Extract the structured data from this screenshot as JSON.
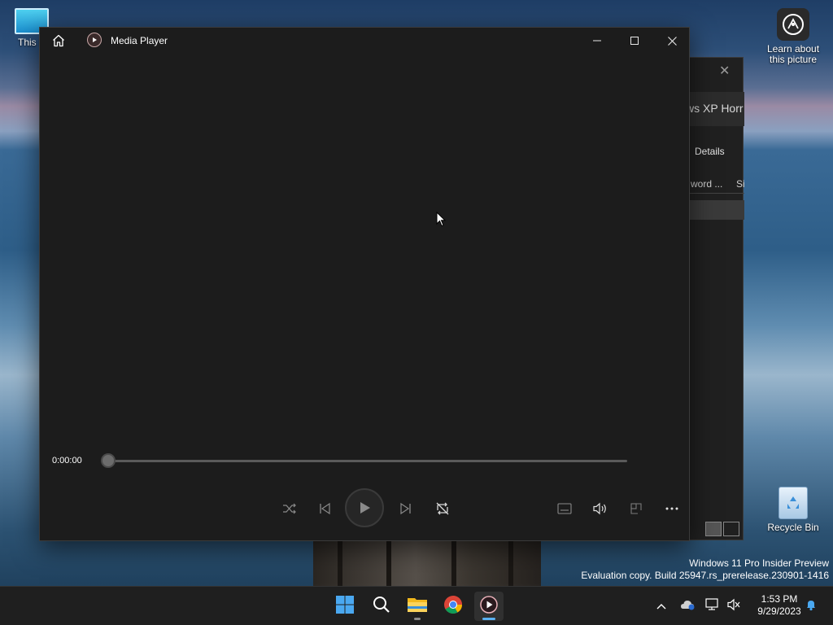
{
  "desktop": {
    "icons": [
      {
        "label": "This PC",
        "visible_label": "This P"
      },
      {
        "label": "Learn about this picture",
        "line1": "Learn about",
        "line2": "this picture"
      },
      {
        "label": "Recycle Bin"
      }
    ],
    "watermark": {
      "line1": "Windows 11 Pro Insider Preview",
      "line2": "Evaluation copy. Build 25947.rs_prerelease.230901-1416"
    }
  },
  "background_window": {
    "title_fragment": "ws XP Horr",
    "details_label": "Details",
    "column1": "word ...",
    "column2": "Si"
  },
  "media_player": {
    "title": "Media Player",
    "time_elapsed": "0:00:00",
    "progress": 0.0,
    "controls": {
      "shuffle": "shuffle-icon",
      "previous": "previous-icon",
      "play": "play-icon",
      "next": "next-icon",
      "repeat": "repeat-icon",
      "captions": "captions-icon",
      "volume": "volume-icon",
      "mini_player": "mini-player-icon",
      "more": "more-icon"
    }
  },
  "taskbar": {
    "apps": [
      "start",
      "search",
      "file-explorer",
      "chrome",
      "media-player"
    ],
    "active_app": "media-player",
    "clock": {
      "time": "1:53 PM",
      "date": "9/29/2023"
    }
  },
  "colors": {
    "player_bg": "#1c1c1c",
    "taskbar_bg": "#1f1f1f",
    "accent": "#5ab0f0"
  }
}
